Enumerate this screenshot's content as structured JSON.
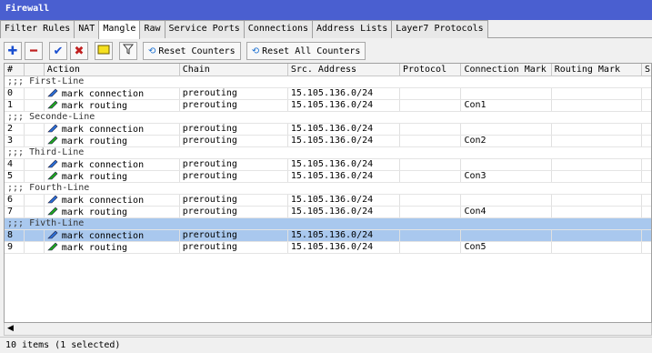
{
  "window": {
    "title": "Firewall"
  },
  "tabs": [
    {
      "label": "Filter Rules",
      "active": false
    },
    {
      "label": "NAT",
      "active": false
    },
    {
      "label": "Mangle",
      "active": true
    },
    {
      "label": "Raw",
      "active": false
    },
    {
      "label": "Service Ports",
      "active": false
    },
    {
      "label": "Connections",
      "active": false
    },
    {
      "label": "Address Lists",
      "active": false
    },
    {
      "label": "Layer7 Protocols",
      "active": false
    }
  ],
  "toolbar": {
    "add_icon": "plus-icon",
    "remove_icon": "minus-icon",
    "enable_icon": "check-icon",
    "disable_icon": "x-icon",
    "comment_icon": "note-icon",
    "filter_icon": "funnel-icon",
    "reset_counters": "Reset Counters",
    "reset_all_counters": "Reset All Counters",
    "add_color": "#1a4fd0",
    "remove_color": "#c02020"
  },
  "columns": [
    "#",
    "",
    "Action",
    "Chain",
    "Src. Address",
    "Protocol",
    "Connection Mark",
    "Routing Mark",
    "S"
  ],
  "rows": [
    {
      "type": "comment",
      "text": ";;; First-Line"
    },
    {
      "type": "rule",
      "num": "0",
      "action": "mark connection",
      "icon": "pencil-blue-icon",
      "chain": "prerouting",
      "src": "15.105.136.0/24",
      "protocol": "",
      "conn_mark": "",
      "routing_mark": ""
    },
    {
      "type": "rule",
      "num": "1",
      "action": "mark routing",
      "icon": "pencil-green-icon",
      "chain": "prerouting",
      "src": "15.105.136.0/24",
      "protocol": "",
      "conn_mark": "Con1",
      "routing_mark": ""
    },
    {
      "type": "comment",
      "text": ";;; Seconde-Line"
    },
    {
      "type": "rule",
      "num": "2",
      "action": "mark connection",
      "icon": "pencil-blue-icon",
      "chain": "prerouting",
      "src": "15.105.136.0/24",
      "protocol": "",
      "conn_mark": "",
      "routing_mark": ""
    },
    {
      "type": "rule",
      "num": "3",
      "action": "mark routing",
      "icon": "pencil-green-icon",
      "chain": "prerouting",
      "src": "15.105.136.0/24",
      "protocol": "",
      "conn_mark": "Con2",
      "routing_mark": ""
    },
    {
      "type": "comment",
      "text": ";;; Third-Line"
    },
    {
      "type": "rule",
      "num": "4",
      "action": "mark connection",
      "icon": "pencil-blue-icon",
      "chain": "prerouting",
      "src": "15.105.136.0/24",
      "protocol": "",
      "conn_mark": "",
      "routing_mark": ""
    },
    {
      "type": "rule",
      "num": "5",
      "action": "mark routing",
      "icon": "pencil-green-icon",
      "chain": "prerouting",
      "src": "15.105.136.0/24",
      "protocol": "",
      "conn_mark": "Con3",
      "routing_mark": ""
    },
    {
      "type": "comment",
      "text": ";;; Fourth-Line"
    },
    {
      "type": "rule",
      "num": "6",
      "action": "mark connection",
      "icon": "pencil-blue-icon",
      "chain": "prerouting",
      "src": "15.105.136.0/24",
      "protocol": "",
      "conn_mark": "",
      "routing_mark": ""
    },
    {
      "type": "rule",
      "num": "7",
      "action": "mark routing",
      "icon": "pencil-green-icon",
      "chain": "prerouting",
      "src": "15.105.136.0/24",
      "protocol": "",
      "conn_mark": "Con4",
      "routing_mark": ""
    },
    {
      "type": "comment",
      "text": ";;; Fivth-Line",
      "selected": true
    },
    {
      "type": "rule",
      "num": "8",
      "action": "mark connection",
      "icon": "pencil-blue-icon",
      "chain": "prerouting",
      "src": "15.105.136.0/24",
      "protocol": "",
      "conn_mark": "",
      "routing_mark": "",
      "selected": true
    },
    {
      "type": "rule",
      "num": "9",
      "action": "mark routing",
      "icon": "pencil-green-icon",
      "chain": "prerouting",
      "src": "15.105.136.0/24",
      "protocol": "",
      "conn_mark": "Con5",
      "routing_mark": ""
    }
  ],
  "status": {
    "text": "10 items (1 selected)"
  },
  "colors": {
    "titlebar": "#4a5fd0",
    "selection": "#a9c8ee"
  }
}
